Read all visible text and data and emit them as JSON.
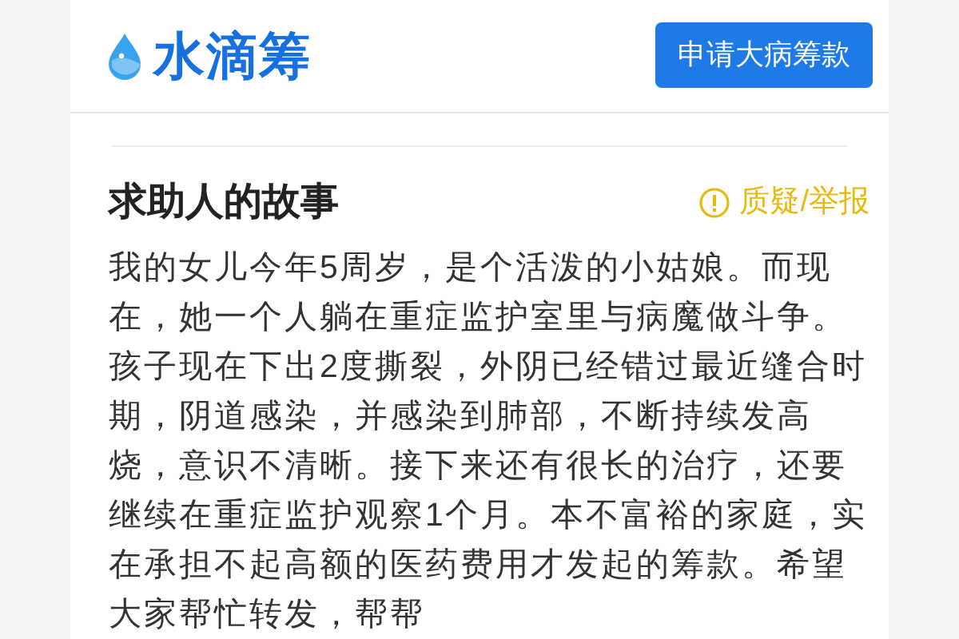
{
  "header": {
    "logo_text": "水滴筹",
    "button": "申请大病筹款"
  },
  "story": {
    "title": "求助人的故事",
    "report_link": "质疑/举报",
    "body": "我的女儿今年5周岁，是个活泼的小姑娘。而现在，她一个人躺在重症监护室里与病魔做斗争。孩子现在下出2度撕裂，外阴已经错过最近缝合时期，阴道感染，并感染到肺部，不断持续发高烧，意识不清晰。接下来还有很长的治疗，还要继续在重症监护观察1个月。本不富裕的家庭，实在承担不起高额的医药费用才发起的筹款。希望大家帮忙转发，帮帮"
  }
}
